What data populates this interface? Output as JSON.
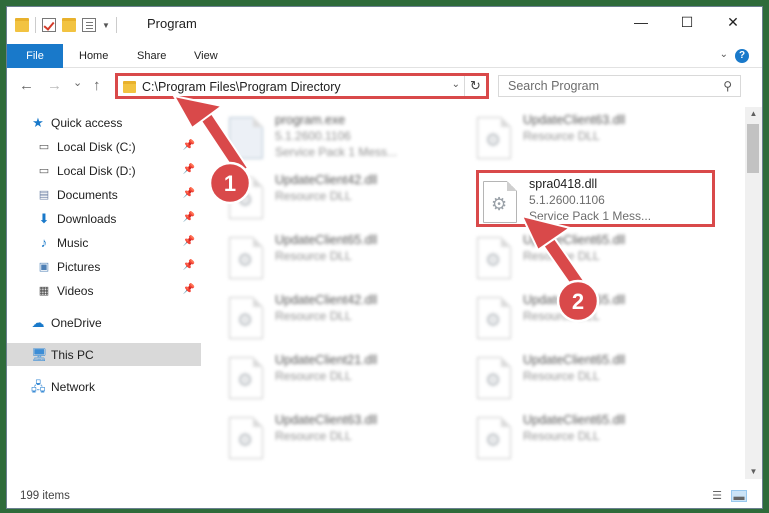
{
  "window": {
    "title": "Program",
    "controls": {
      "minimize": "—",
      "maximize": "☐",
      "close": "✕"
    }
  },
  "ribbon": {
    "tabs": [
      {
        "label": "File"
      },
      {
        "label": "Home"
      },
      {
        "label": "Share"
      },
      {
        "label": "View"
      }
    ],
    "accent": "#1979ca"
  },
  "nav": {
    "back": "←",
    "forward": "→",
    "recent": "⌄",
    "up": "↑",
    "address": "C:\\Program Files\\Program Directory",
    "search_placeholder": "Search Program"
  },
  "sidebar": {
    "quick_access": "Quick access",
    "items": [
      {
        "label": "Local Disk (C:)"
      },
      {
        "label": "Local Disk (D:)"
      },
      {
        "label": "Documents"
      },
      {
        "label": "Downloads"
      },
      {
        "label": "Music"
      },
      {
        "label": "Pictures"
      },
      {
        "label": "Videos"
      }
    ],
    "onedrive": "OneDrive",
    "thispc": "This PC",
    "network": "Network"
  },
  "files": {
    "left": [
      {
        "name": "program.exe",
        "line2": "5.1.2600.1106",
        "line3": "Service Pack 1 Mess..."
      },
      {
        "name": "UpdateClient42.dll",
        "line2": "Resource DLL"
      },
      {
        "name": "UpdateClient65.dll",
        "line2": "Resource DLL"
      },
      {
        "name": "UpdateClient42.dll",
        "line2": "Resource DLL"
      },
      {
        "name": "UpdateClient21.dll",
        "line2": "Resource DLL"
      },
      {
        "name": "UpdateClient63.dll",
        "line2": "Resource DLL"
      }
    ],
    "right": [
      {
        "name": "UpdateClient63.dll",
        "line2": "Resource DLL"
      },
      {
        "name": "spra0418.dll",
        "line2": "5.1.2600.1106",
        "line3": "Service Pack 1 Mess..."
      },
      {
        "name": "UpdateClient65.dll",
        "line2": "Resource DLL"
      },
      {
        "name": "UpdateClient65.dll",
        "line2": "Resource DLL"
      },
      {
        "name": "UpdateClient65.dll",
        "line2": "Resource DLL"
      },
      {
        "name": "UpdateClient65.dll",
        "line2": "Resource DLL"
      }
    ]
  },
  "status": {
    "count": "199 items"
  },
  "annotations": {
    "step1": "1",
    "step2": "2",
    "color": "#d9494a"
  }
}
